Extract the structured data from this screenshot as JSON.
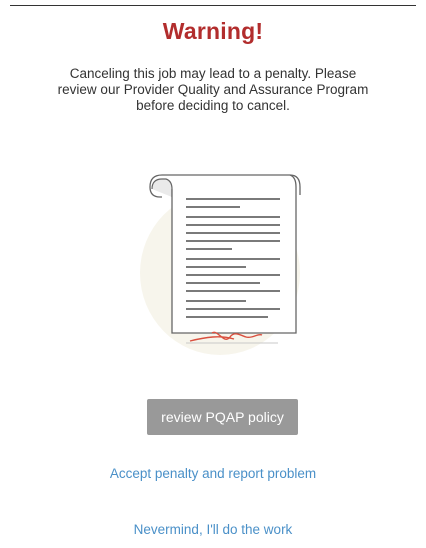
{
  "dialog": {
    "title": "Warning!",
    "message": "Canceling this job may lead to a penalty. Please review our Provider Quality and Assurance Program before deciding to cancel.",
    "illustration_icon": "document-scroll-with-signature",
    "primary_button_label": "review PQAP policy",
    "accept_link_label": "Accept penalty and  report problem",
    "nevermind_link_label": "Nevermind, I'll do the work"
  },
  "colors": {
    "title": "#b22d2d",
    "link": "#4a90c8",
    "button_bg": "#999999",
    "signature": "#d9503f"
  }
}
